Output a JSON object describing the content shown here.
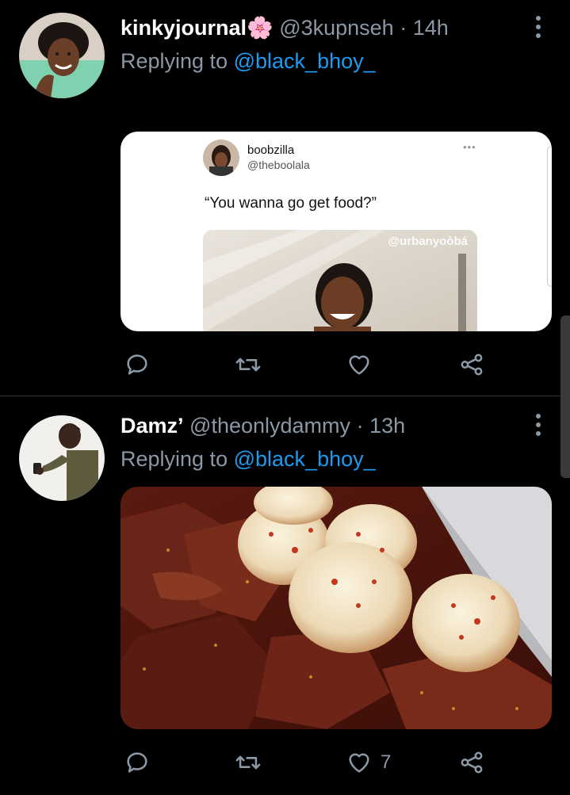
{
  "tweets": [
    {
      "display_name": "kinkyjournal🌸",
      "handle": "@3kupnseh",
      "time": "14h",
      "replying_label": "Replying to",
      "replying_to": "@black_bhoy_",
      "embedded": {
        "name": "boobzilla",
        "handle": "@theboolala",
        "more": "•••",
        "text": "“You wanna go get food?”",
        "watermark": "@urbanyoòbá"
      },
      "likes": ""
    },
    {
      "display_name": "Damz’",
      "handle": "@theonlydammy",
      "time": "13h",
      "replying_label": "Replying to",
      "replying_to": "@black_bhoy_",
      "likes": "7"
    }
  ],
  "icons": [
    "reply-icon",
    "retweet-icon",
    "like-icon",
    "share-icon",
    "more-icon"
  ],
  "colors": {
    "background": "#000000",
    "accent": "#1d9bf0",
    "muted": "#8b98a5",
    "divider": "#2f3336"
  }
}
